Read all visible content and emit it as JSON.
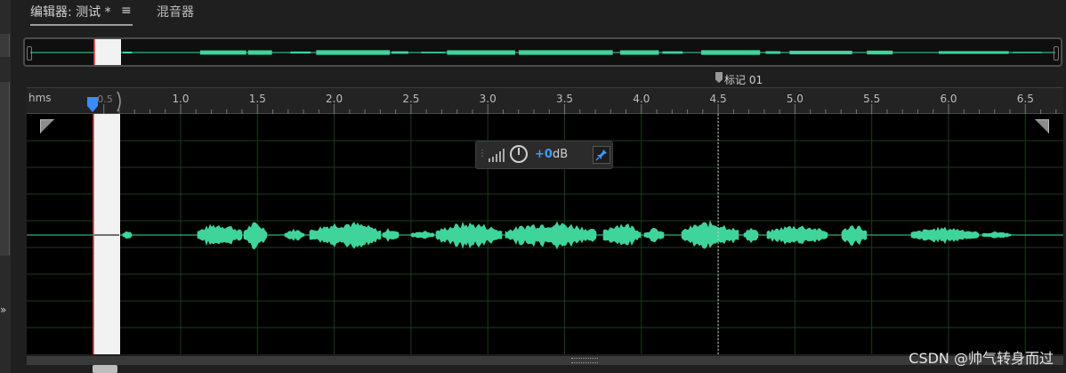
{
  "tabs": {
    "editor_label": "编辑器: 测试 *",
    "menu_glyph": "≡",
    "mixer_label": "混音器"
  },
  "marker": {
    "label": "标记 01"
  },
  "ruler": {
    "unit": "hms",
    "ticks": [
      "1.0",
      "1.5",
      "2.0",
      "2.5",
      "3.0",
      "3.5",
      "4.0",
      "4.5",
      "5.0",
      "5.5",
      "6.0",
      "6.5"
    ],
    "playhead_label": "0.5"
  },
  "hud": {
    "value": "+0",
    "unit": "dB"
  },
  "watermark": "CSDN @帅气转身而过",
  "icons": {
    "collapse": "chevron-right-icon",
    "corner_left": "fade-in-handle-icon",
    "corner_right": "fade-out-handle-icon",
    "knob": "volume-knob-icon",
    "pin": "pin-icon",
    "meter": "level-meter-icon"
  },
  "colors": {
    "waveform": "#3fd49a",
    "playhead": "#3b8bff",
    "selection": "#f2f2f2",
    "grid": "#1b3b1b",
    "accent_value": "#3b9cff"
  }
}
